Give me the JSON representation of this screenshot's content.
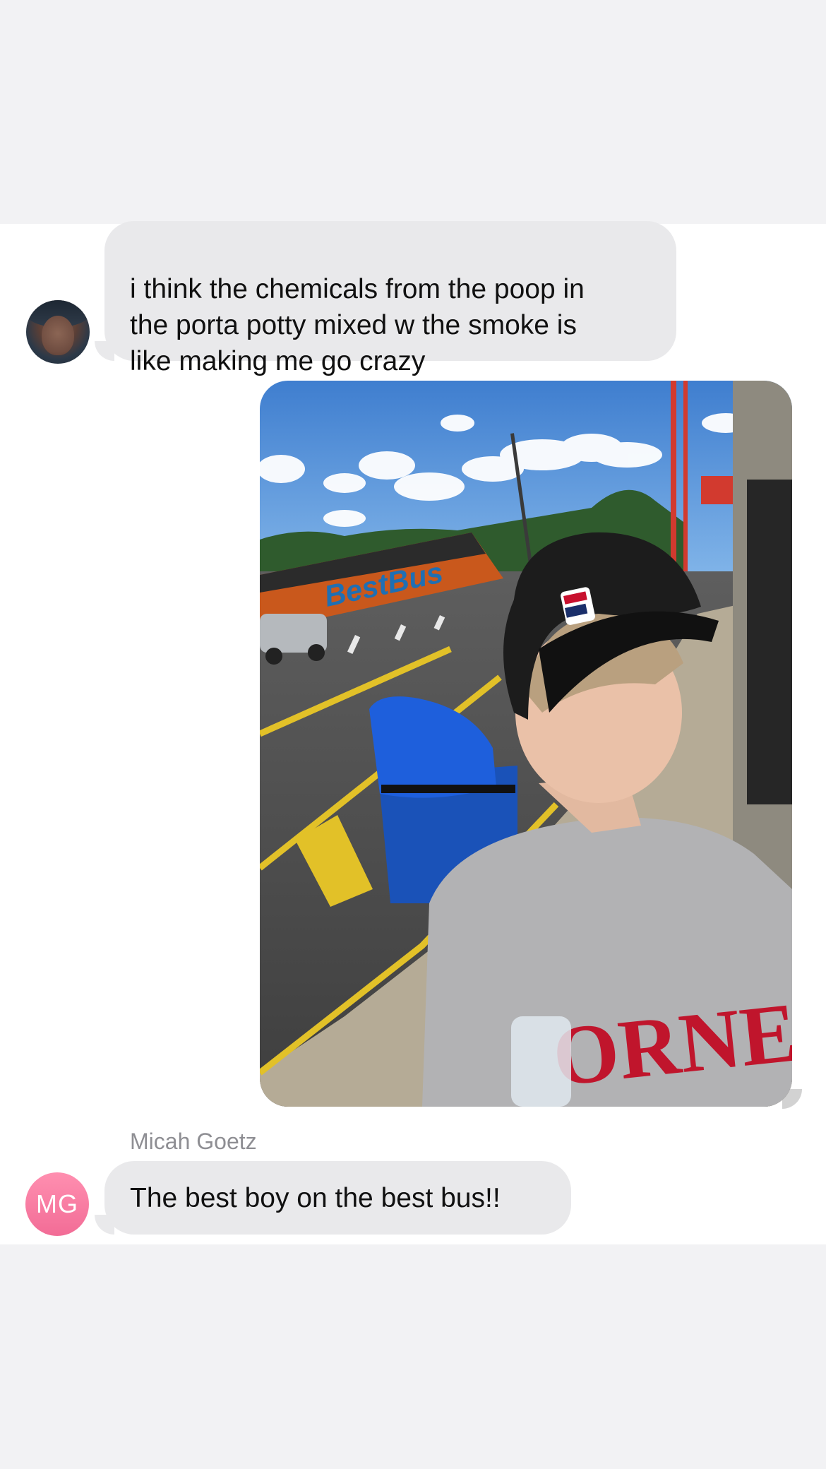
{
  "thread": {
    "messages": [
      {
        "direction": "incoming",
        "avatar_icon": "contact-photo-avatar",
        "text": "i think the chemicals from the poop in\nthe porta potty mixed w the smoke is\nlike making me go crazy"
      },
      {
        "direction": "outgoing",
        "type": "photo",
        "brand_text": "BestBus",
        "sweatshirt_text": "ORNELL"
      },
      {
        "direction": "incoming",
        "sender_name": "Micah Goetz",
        "avatar_initials": "MG",
        "text": "The best boy on the best bus!!"
      }
    ]
  },
  "colors": {
    "incoming_bubble": "#e9e9eb",
    "background": "#f2f2f4",
    "initials_avatar": "#f6799f"
  }
}
